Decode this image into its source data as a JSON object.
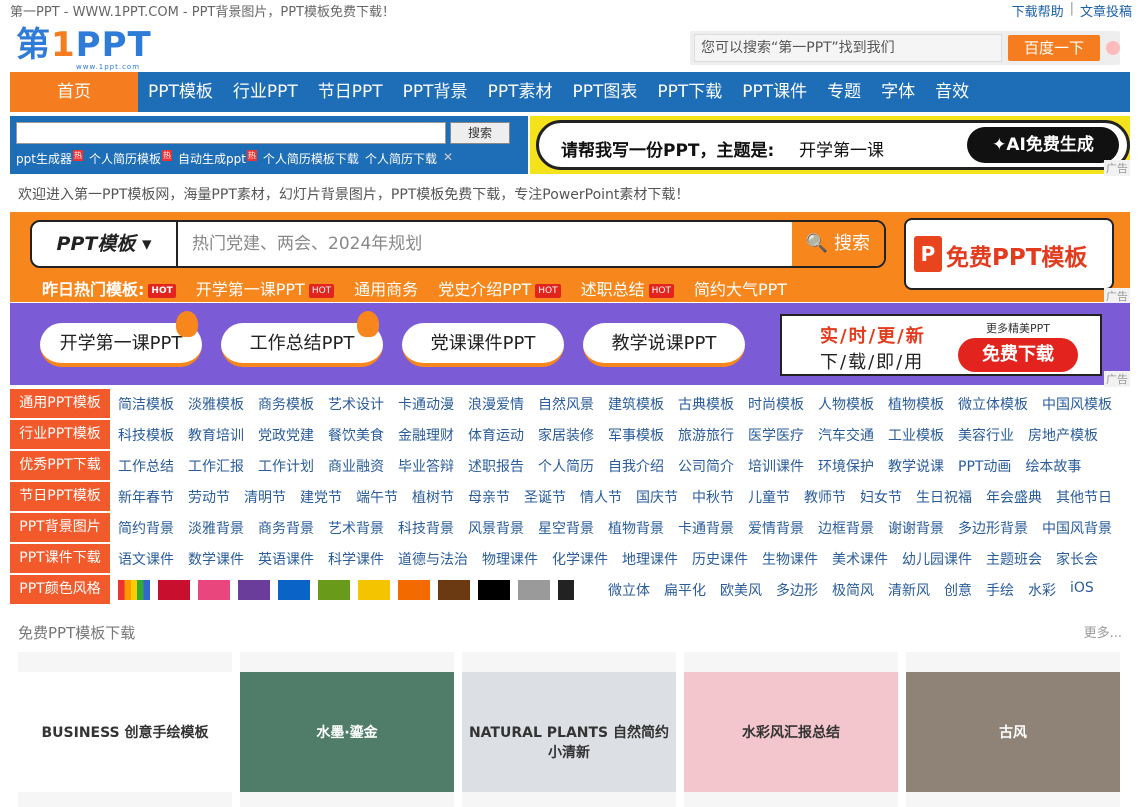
{
  "topbar": {
    "site_title": "第一PPT - WWW.1PPT.COM - PPT背景图片，PPT模板免费下载！",
    "help": "下载帮助",
    "sep": "|",
    "submit": "文章投稿"
  },
  "logo": {
    "part1": "第",
    "part2": "1",
    "part3": "PPT",
    "sub": "www.1ppt.com"
  },
  "search": {
    "placeholder": "您可以搜索“第一PPT”找到我们",
    "button": "百度一下"
  },
  "nav": {
    "home": "首页",
    "items": [
      "PPT模板",
      "行业PPT",
      "节日PPT",
      "PPT背景",
      "PPT素材",
      "PPT图表",
      "PPT下载",
      "PPT课件",
      "专题",
      "字体",
      "音效"
    ]
  },
  "mini_search": {
    "button": "搜索",
    "links": [
      "ppt生成器",
      "个人简历模板",
      "自动生成ppt",
      "个人简历模板下载",
      "个人简历下载"
    ],
    "hot": "热",
    "close": "✕"
  },
  "ai_banner": {
    "question": "请帮我写一份PPT，主题是:",
    "topic": "开学第一课",
    "button": "✦AI免费生成",
    "ad": "广告"
  },
  "welcome": "欢迎进入第一PPT模板网，海量PPT素材，幻灯片背景图片，PPT模板免费下载，专注PowerPoint素材下载！",
  "orange_search": {
    "select": "PPT模板 ▾",
    "placeholder": "热门党建、两会、2024年规划",
    "button": "🔍 搜索",
    "right_logo": "P",
    "right_text": "免费PPT模板",
    "ad": "广告"
  },
  "hotline": {
    "label": "昨日热门模板:",
    "items": [
      "开学第一课PPT",
      "通用商务",
      "党史介绍PPT",
      "述职总结",
      "简约大气PPT"
    ],
    "hot": "HOT"
  },
  "purple": {
    "pills": [
      "开学第一课PPT",
      "工作总结PPT",
      "党课课件PPT",
      "教学说课PPT"
    ],
    "promo_a": "实/时/更/新",
    "promo_b": "下/载/即/用",
    "promo_c": "更多精美PPT",
    "promo_btn": "免费下载",
    "ad": "广告"
  },
  "categories": [
    {
      "label": "通用PPT模板",
      "links": [
        "简洁模板",
        "淡雅模板",
        "商务模板",
        "艺术设计",
        "卡通动漫",
        "浪漫爱情",
        "自然风景",
        "建筑模板",
        "古典模板",
        "时尚模板",
        "人物模板",
        "植物模板",
        "微立体模板",
        "中国风模板"
      ]
    },
    {
      "label": "行业PPT模板",
      "links": [
        "科技模板",
        "教育培训",
        "党政党建",
        "餐饮美食",
        "金融理财",
        "体育运动",
        "家居装修",
        "军事模板",
        "旅游旅行",
        "医学医疗",
        "汽车交通",
        "工业模板",
        "美容行业",
        "房地产模板"
      ]
    },
    {
      "label": "优秀PPT下载",
      "links": [
        "工作总结",
        "工作汇报",
        "工作计划",
        "商业融资",
        "毕业答辩",
        "述职报告",
        "个人简历",
        "自我介绍",
        "公司简介",
        "培训课件",
        "环境保护",
        "教学说课",
        "PPT动画",
        "绘本故事"
      ]
    },
    {
      "label": "节日PPT模板",
      "links": [
        "新年春节",
        "劳动节",
        "清明节",
        "建党节",
        "端午节",
        "植树节",
        "母亲节",
        "圣诞节",
        "情人节",
        "国庆节",
        "中秋节",
        "儿童节",
        "教师节",
        "妇女节",
        "生日祝福",
        "年会盛典",
        "其他节日"
      ]
    },
    {
      "label": "PPT背景图片",
      "links": [
        "简约背景",
        "淡雅背景",
        "商务背景",
        "艺术背景",
        "科技背景",
        "风景背景",
        "星空背景",
        "植物背景",
        "卡通背景",
        "爱情背景",
        "边框背景",
        "谢谢背景",
        "多边形背景",
        "中国风背景"
      ]
    },
    {
      "label": "PPT课件下载",
      "links": [
        "语文课件",
        "数学课件",
        "英语课件",
        "科学课件",
        "道德与法治",
        "物理课件",
        "化学课件",
        "地理课件",
        "历史课件",
        "生物课件",
        "美术课件",
        "幼儿园课件",
        "主题班会",
        "家长会"
      ]
    }
  ],
  "color_row": {
    "label": "PPT颜色风格",
    "swatches": [
      "#c8102e",
      "#e8467c",
      "#6a3d9a",
      "#0a64c8",
      "#6a9a1a",
      "#f5c400",
      "#f26a00",
      "#6b3a12",
      "#000000",
      "#9a9a9a",
      "#222222"
    ],
    "styles": [
      "微立体",
      "扁平化",
      "欧美风",
      "多边形",
      "极简风",
      "清新风",
      "创意",
      "手绘",
      "水彩",
      "iOS"
    ]
  },
  "section": {
    "title": "免费PPT模板下载",
    "more": "更多..."
  },
  "thumbs": [
    {
      "name": "business-handdrawn",
      "bg": "#ffffff",
      "text": "BUSINESS 创意手绘模板"
    },
    {
      "name": "shuimo-golden",
      "bg": "#4f7d69",
      "text": "水墨·鎏金"
    },
    {
      "name": "natural-plants",
      "bg": "#dcdfe3",
      "text": "NATURAL PLANTS 自然简约小清新"
    },
    {
      "name": "watercolor-report",
      "bg": "#f2c6cc",
      "text": "水彩风汇报总结"
    },
    {
      "name": "gufeng",
      "bg": "#8f8377",
      "text": "古风"
    }
  ]
}
